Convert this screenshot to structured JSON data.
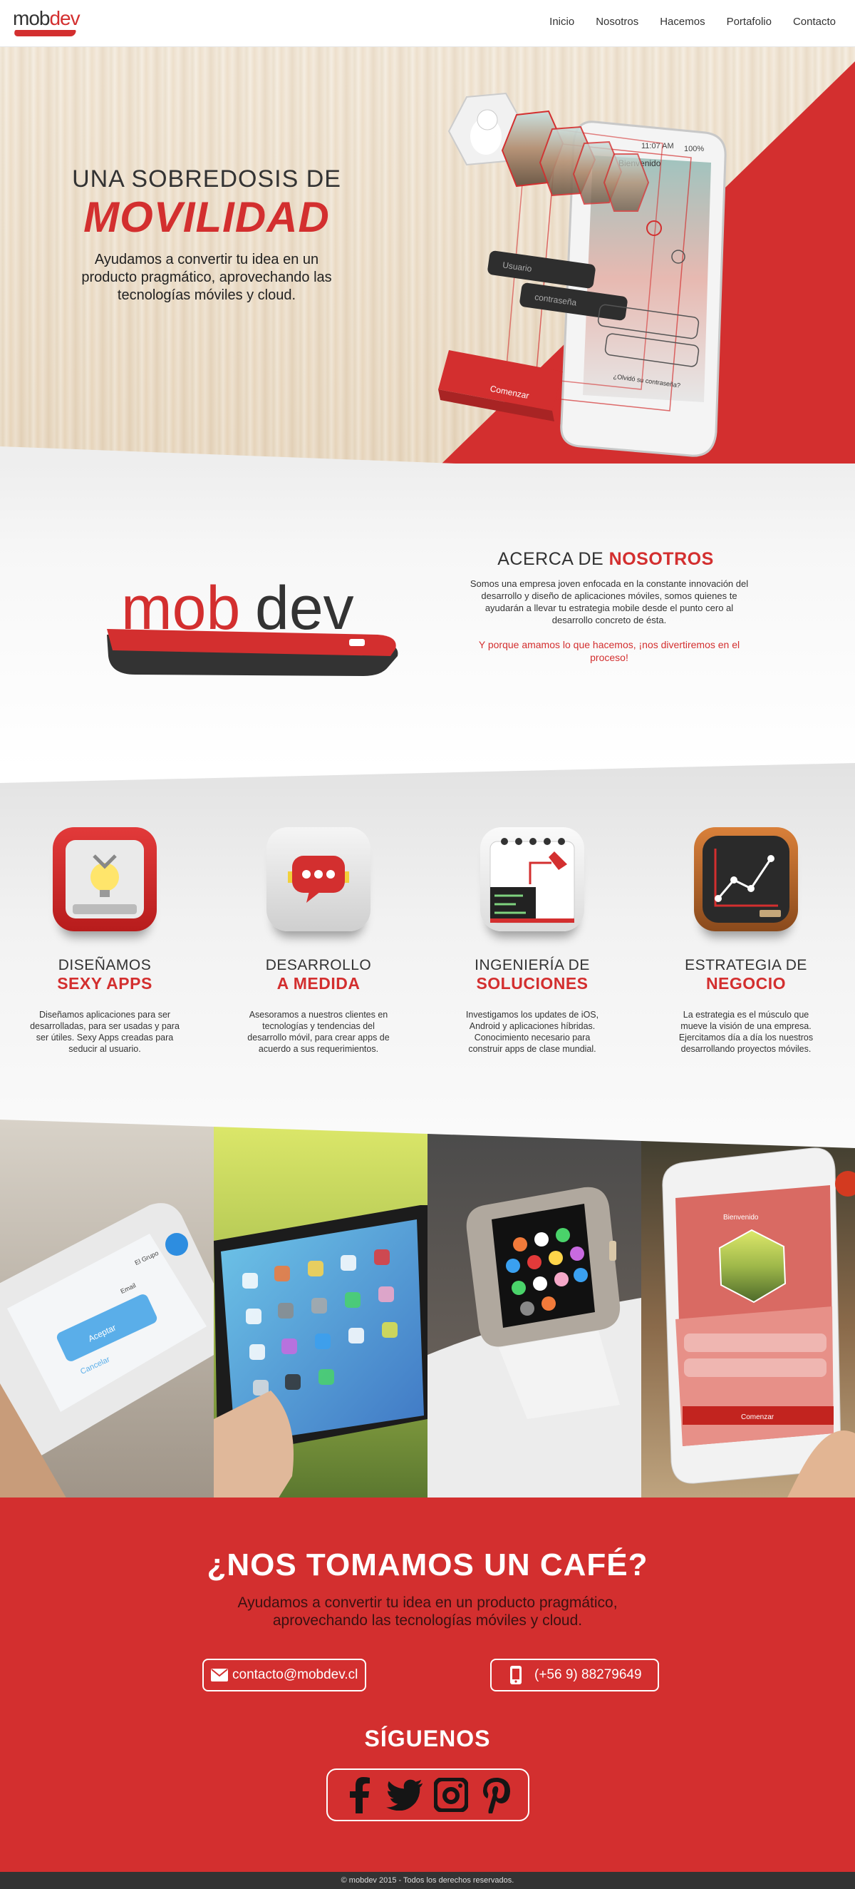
{
  "nav": {
    "logo_a": "mob",
    "logo_b": "dev",
    "items": [
      "Inicio",
      "Nosotros",
      "Hacemos",
      "Portafolio",
      "Contacto"
    ]
  },
  "hero": {
    "line1": "UNA SOBREDOSIS DE",
    "line2": "MOVILIDAD",
    "description": "Ayudamos a convertir tu idea en un producto pragmático, aprovechando las tecnologías móviles y cloud.",
    "phone": {
      "status_time": "11:07 AM",
      "status_battery": "100%",
      "screen_title": "Bienvenido",
      "user_placeholder": "Usuario",
      "pass_placeholder": "contraseña",
      "forgot": "¿Olvidó su contraseña?",
      "start_button": "Comenzar"
    }
  },
  "about": {
    "logo_a": "mob",
    "logo_b": "dev",
    "title_a": "ACERCA DE ",
    "title_b": "NOSOTROS",
    "paragraph": "Somos una empresa joven enfocada en la constante innovación del desarrollo y diseño de aplicaciones móviles, somos quienes te ayudarán a llevar tu estrategia mobile desde el punto cero al desarrollo concreto de ésta.",
    "quote": "Y porque amamos lo que hacemos, ¡nos divertiremos en el proceso!"
  },
  "services": [
    {
      "t1": "DISEÑAMOS",
      "t2": "SEXY APPS",
      "icon": "bulb-claw-icon",
      "text": "Diseñamos aplicaciones para ser desarrolladas, para ser usadas y para ser útiles. Sexy Apps creadas para seducir al usuario."
    },
    {
      "t1": "DESARROLLO",
      "t2": "A MEDIDA",
      "icon": "chat-bubble-icon",
      "text": "Asesoramos a nuestros clientes en tecnologías y tendencias del desarrollo móvil, para crear apps de acuerdo a sus requerimientos."
    },
    {
      "t1": "INGENIERÍA DE",
      "t2": "SOLUCIONES",
      "icon": "notepad-icon",
      "text": "Investigamos los updates de iOS, Android y aplicaciones híbridas. Conocimiento necesario para construir apps de clase mundial."
    },
    {
      "t1": "ESTRATEGIA DE",
      "t2": "NEGOCIO",
      "icon": "chalkboard-chart-icon",
      "text": "La estrategia es el músculo que mueve la visión de una empresa. Ejercitamos día a día los nuestros desarrollando proyectos móviles."
    }
  ],
  "photos": {
    "p1_group": "El Grupo",
    "p1_email": "Email",
    "p1_accept": "Aceptar",
    "p1_cancel": "Cancelar",
    "p4_title": "Bienvenido",
    "p4_start": "Comenzar"
  },
  "contact": {
    "title": "¿NOS TOMAMOS UN CAFÉ?",
    "subtitle": "Ayudamos a convertir tu idea en un producto pragmático, aprovechando las tecnologías móviles y cloud.",
    "email": "contacto@mobdev.cl",
    "phone": "(+56 9) 88279649",
    "follow": "SÍGUENOS"
  },
  "footer": "© mobdev 2015 - Todos los derechos reservados.",
  "colors": {
    "brand_red": "#d32f2f",
    "dark": "#333333"
  }
}
